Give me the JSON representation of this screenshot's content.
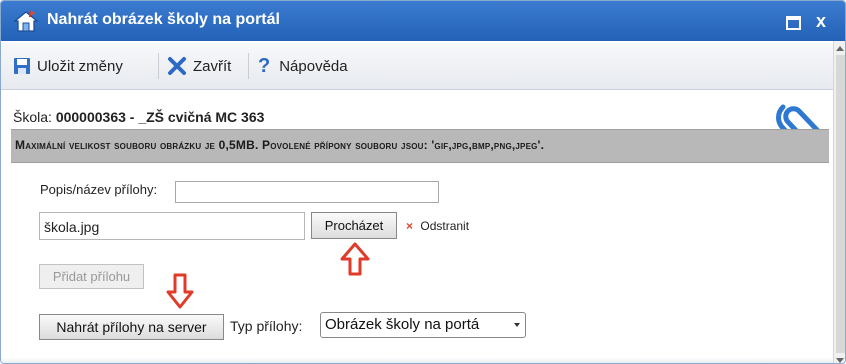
{
  "window": {
    "title": "Nahrát obrázek školy na portál",
    "icons": [
      "school-icon",
      "maximize-icon",
      "close-icon"
    ],
    "accent_color": "#2e6cc4"
  },
  "toolbar": {
    "save_label": "Uložit změny",
    "close_label": "Zavřít",
    "help_label": "Nápověda",
    "help_icon": "?",
    "close_icon": "X"
  },
  "school": {
    "label": "Škola:",
    "value": "000000363 - _ZŠ cvičná MC 363"
  },
  "info": {
    "text": "Maximální velikost souboru obrázku je 0,5MB. Povolené přípony souboru jsou: 'gif,jpg,bmp,png,jpeg'."
  },
  "form": {
    "description_label": "Popis/název přílohy:",
    "description_value": "",
    "file_value": "škola.jpg",
    "browse_label": "Procházet",
    "remove_label": "Odstranit",
    "remove_icon": "×",
    "add_label": "Přidat přílohu",
    "upload_label": "Nahrát přílohy na server",
    "type_label": "Typ přílohy:",
    "type_value": "Obrázek školy na portá"
  },
  "colors": {
    "annotation_arrow": "#e03a28",
    "info_band": "#b8b8b8"
  }
}
